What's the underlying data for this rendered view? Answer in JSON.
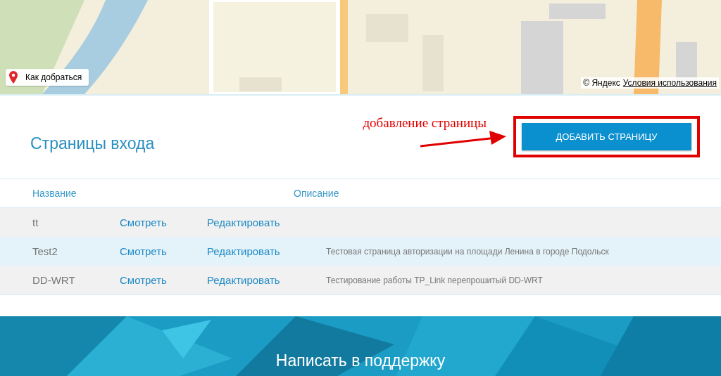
{
  "map": {
    "route_button": "Как добраться",
    "copyright": "© Яндекс",
    "terms_link": "Условия использования"
  },
  "section": {
    "title": "Страницы входа",
    "add_button": "ДОБАВИТЬ СТРАНИЦУ",
    "annotation": {
      "text": "добавление страницы",
      "color": "#e00000"
    }
  },
  "table": {
    "columns": [
      "Название",
      "Описание"
    ],
    "rows": [
      {
        "name": "tt",
        "view": "Смотреть",
        "edit": "Редактировать",
        "highlighted": false
      },
      {
        "name": "Test2",
        "view": "Смотреть",
        "edit": "Редактировать",
        "description": "Тестовая страница авторизации на площади Ленина в городе Подольск",
        "highlighted": true
      },
      {
        "name": "DD-WRT",
        "view": "Смотреть",
        "edit": "Редактировать",
        "description": "Тестирование работы TP_Link перепрошитый DD-WRT",
        "highlighted": false
      }
    ]
  },
  "footer": {
    "support_link": "Написать в поддержку"
  }
}
